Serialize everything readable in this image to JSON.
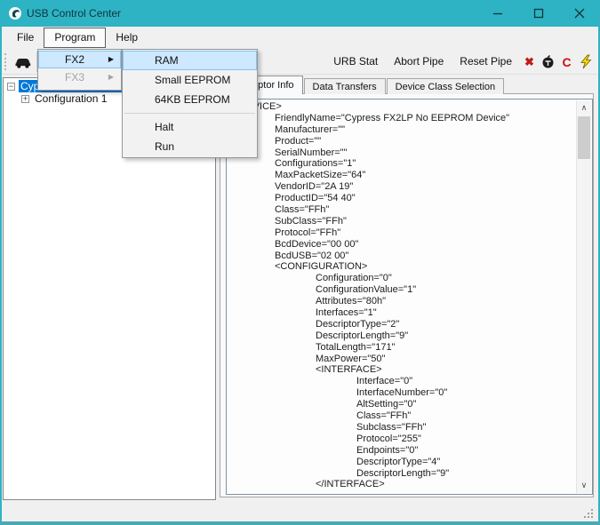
{
  "window": {
    "title": "USB Control Center"
  },
  "menubar": {
    "items": [
      {
        "label": "File",
        "open": false
      },
      {
        "label": "Program",
        "open": true
      },
      {
        "label": "Help",
        "open": false
      }
    ]
  },
  "menus": {
    "program": {
      "items": [
        {
          "label": "FX2",
          "submenu": true,
          "highlighted": true,
          "disabled": false
        },
        {
          "label": "FX3",
          "submenu": true,
          "highlighted": false,
          "disabled": true
        }
      ]
    },
    "fx2": {
      "items": [
        {
          "label": "RAM",
          "highlighted": true
        },
        {
          "label": "Small EEPROM"
        },
        {
          "label": "64KB EEPROM"
        },
        {
          "separator": true
        },
        {
          "label": "Halt"
        },
        {
          "label": "Run"
        }
      ]
    }
  },
  "toolbar": {
    "text_buttons": [
      "URB Stat",
      "Abort Pipe",
      "Reset Pipe"
    ],
    "icon_buttons": [
      {
        "name": "delete-icon",
        "type": "glyph",
        "glyph": "✖",
        "color": "#c11b17",
        "size": "13px"
      },
      {
        "name": "abort-bomb-icon",
        "type": "svg-bomb"
      },
      {
        "name": "reset-icon",
        "type": "glyph",
        "glyph": "C",
        "color": "#cc1111",
        "size": "14px"
      },
      {
        "name": "lightning-icon",
        "type": "svg-bolt"
      }
    ]
  },
  "tree": {
    "root": {
      "label": "Cypress FX2LP No EEPROM Device",
      "selected": true,
      "expander": "−"
    },
    "children": [
      {
        "label": "Configuration 1",
        "expander": "+"
      }
    ]
  },
  "tabs": {
    "active": 0,
    "items": [
      "Descriptor Info",
      "Data Transfers",
      "Device Class Selection"
    ]
  },
  "descriptor": {
    "lines": [
      [
        0,
        "<DEVICE>"
      ],
      [
        1,
        "FriendlyName=\"Cypress FX2LP No EEPROM Device\""
      ],
      [
        1,
        "Manufacturer=\"\""
      ],
      [
        1,
        "Product=\"\""
      ],
      [
        1,
        "SerialNumber=\"\""
      ],
      [
        1,
        "Configurations=\"1\""
      ],
      [
        1,
        "MaxPacketSize=\"64\""
      ],
      [
        1,
        "VendorID=\"2A 19\""
      ],
      [
        1,
        "ProductID=\"54 40\""
      ],
      [
        1,
        "Class=\"FFh\""
      ],
      [
        1,
        "SubClass=\"FFh\""
      ],
      [
        1,
        "Protocol=\"FFh\""
      ],
      [
        1,
        "BcdDevice=\"00 00\""
      ],
      [
        1,
        "BcdUSB=\"02 00\""
      ],
      [
        1,
        "<CONFIGURATION>"
      ],
      [
        2,
        "Configuration=\"0\""
      ],
      [
        2,
        "ConfigurationValue=\"1\""
      ],
      [
        2,
        "Attributes=\"80h\""
      ],
      [
        2,
        "Interfaces=\"1\""
      ],
      [
        2,
        "DescriptorType=\"2\""
      ],
      [
        2,
        "DescriptorLength=\"9\""
      ],
      [
        2,
        "TotalLength=\"171\""
      ],
      [
        2,
        "MaxPower=\"50\""
      ],
      [
        2,
        "<INTERFACE>"
      ],
      [
        3,
        "Interface=\"0\""
      ],
      [
        3,
        "InterfaceNumber=\"0\""
      ],
      [
        3,
        "AltSetting=\"0\""
      ],
      [
        3,
        "Class=\"FFh\""
      ],
      [
        3,
        "Subclass=\"FFh\""
      ],
      [
        3,
        "Protocol=\"255\""
      ],
      [
        3,
        "Endpoints=\"0\""
      ],
      [
        3,
        "DescriptorType=\"4\""
      ],
      [
        3,
        "DescriptorLength=\"9\""
      ],
      [
        2,
        "</INTERFACE>"
      ]
    ]
  },
  "icons": {
    "submenu_arrow": "▶",
    "scroll_up": "∧",
    "scroll_down": "∨",
    "tree_collapse": "−",
    "tree_expand": "+"
  },
  "colors": {
    "titlebar": "#2db3c4",
    "selection": "#0078d7",
    "menu_highlight": "#cde8ff",
    "delete_red": "#c11b17",
    "lightning_yellow": "#ffd800"
  }
}
